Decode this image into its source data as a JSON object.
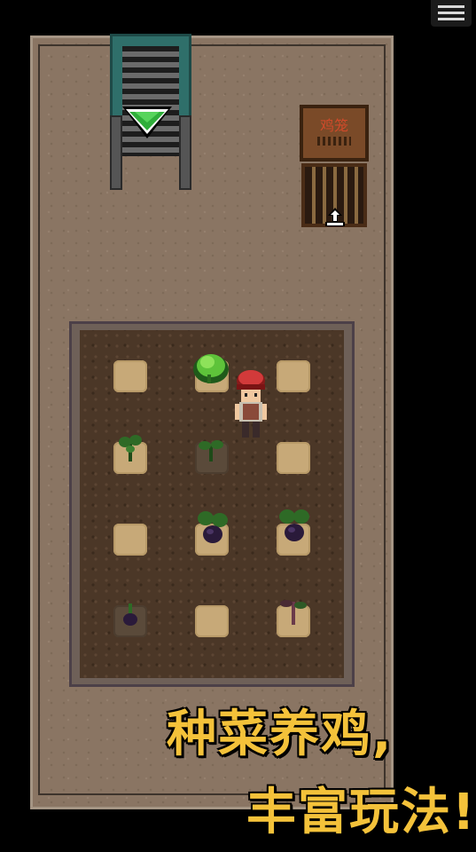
{
  "menu": {
    "icon": "hamburger-menu-icon"
  },
  "room": {
    "stairs": {
      "icon": "green-down-arrow-icon"
    },
    "coop": {
      "sign_label": "鸡笼",
      "icon": "enter-arrow-icon"
    }
  },
  "field": {
    "plots": [
      {
        "row": 1,
        "col": 1,
        "crop": "empty"
      },
      {
        "row": 1,
        "col": 2,
        "crop": "cabbage-grown"
      },
      {
        "row": 1,
        "col": 3,
        "crop": "empty"
      },
      {
        "row": 2,
        "col": 1,
        "crop": "sprout"
      },
      {
        "row": 2,
        "col": 2,
        "crop": "sprout-watered"
      },
      {
        "row": 2,
        "col": 3,
        "crop": "empty"
      },
      {
        "row": 3,
        "col": 1,
        "crop": "empty"
      },
      {
        "row": 3,
        "col": 2,
        "crop": "eggplant"
      },
      {
        "row": 3,
        "col": 3,
        "crop": "eggplant"
      },
      {
        "row": 4,
        "col": 1,
        "crop": "eggplant-seedling-watered"
      },
      {
        "row": 4,
        "col": 2,
        "crop": "empty"
      },
      {
        "row": 4,
        "col": 3,
        "crop": "withered-sprout"
      }
    ]
  },
  "player": {
    "icon": "farmer-character-red-cap"
  },
  "promo": {
    "line1": "种菜养鸡,",
    "line2": "丰富玩法!"
  },
  "colors": {
    "floor": "#8a7563",
    "soil": "#4b3727",
    "promo_text": "#f4c23a",
    "stairs_frame": "#2f6f6a"
  }
}
